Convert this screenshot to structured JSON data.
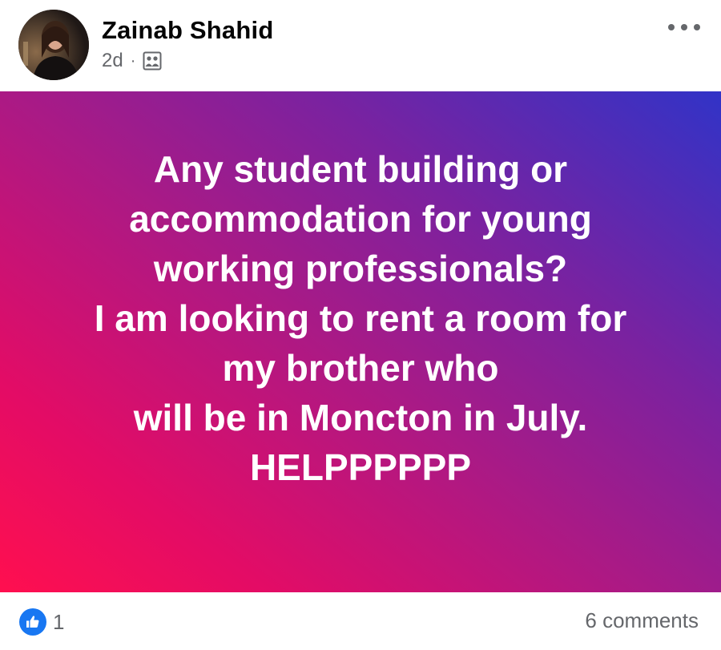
{
  "post": {
    "author": {
      "name": "Zainab Shahid"
    },
    "timestamp": "2d",
    "separator": "·",
    "audience_icon": "group-audience-icon",
    "text": "Any student building or\naccommodation for young\nworking professionals?\nI am looking to rent a room for\nmy brother who\nwill be in Moncton in July.\nHELPPPPPP",
    "background_gradient": [
      "#ff0f4f",
      "#a91a86",
      "#3133c7"
    ]
  },
  "footer": {
    "reaction_icon": "like-icon",
    "reaction_count": "1",
    "comments_label": "6 comments"
  },
  "colors": {
    "brand_blue": "#1877f2",
    "secondary_text": "#65676b",
    "primary_text": "#050505"
  }
}
